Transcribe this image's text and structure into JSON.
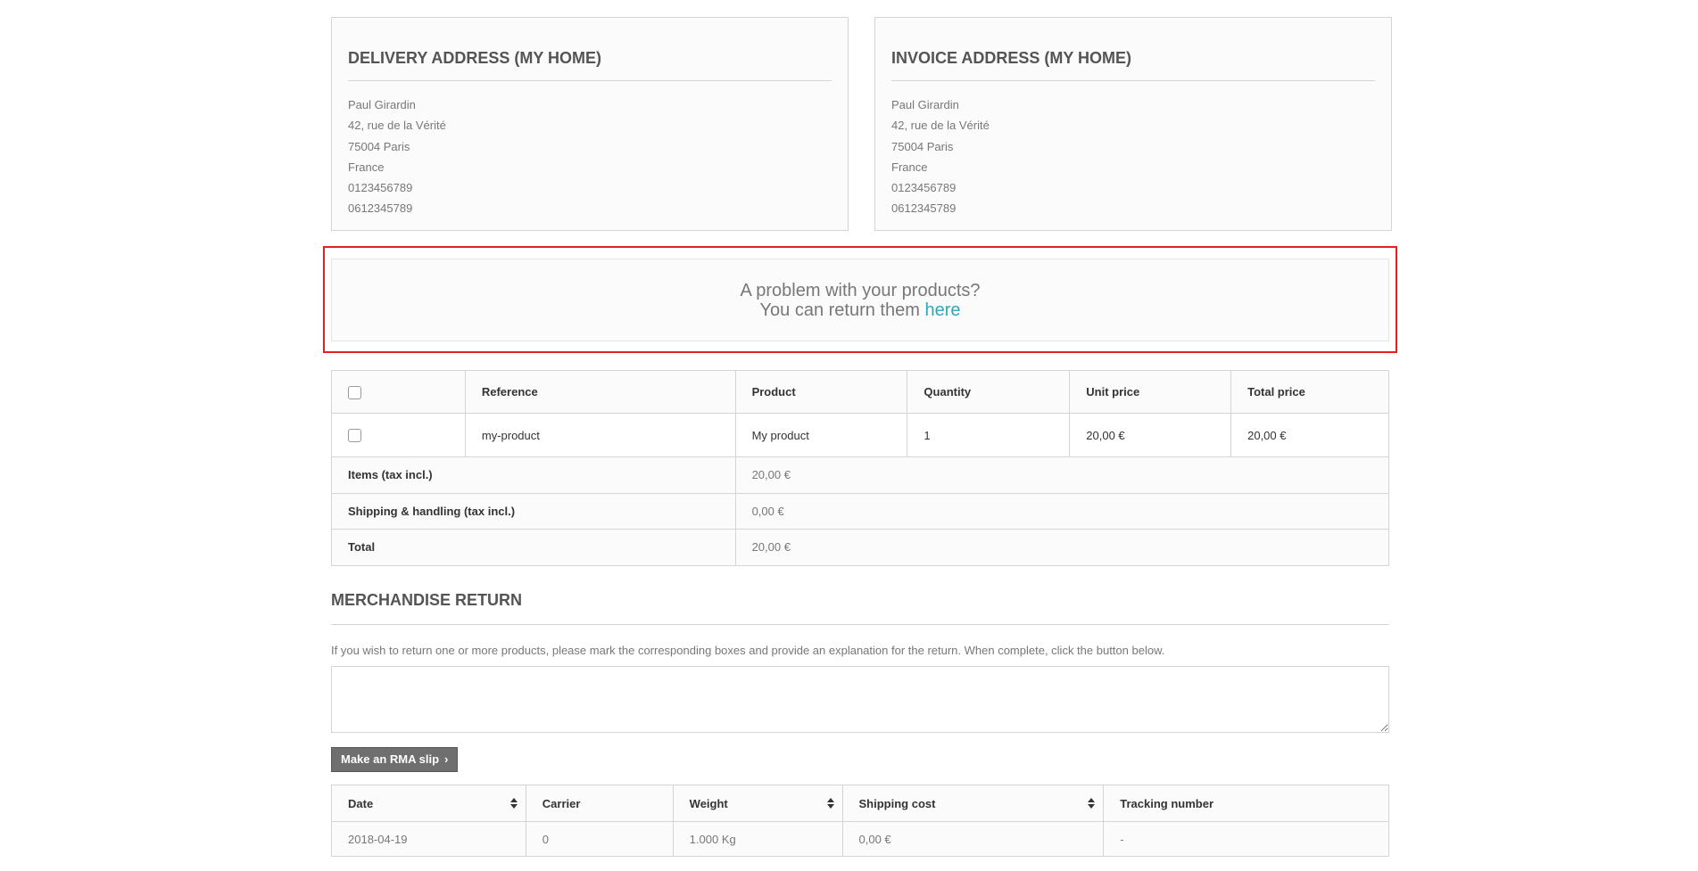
{
  "delivery": {
    "title": "DELIVERY ADDRESS (MY HOME)",
    "lines": [
      "Paul Girardin",
      "42, rue de la Vérité",
      "75004 Paris",
      "France",
      "0123456789",
      "0612345789"
    ]
  },
  "invoice": {
    "title": "INVOICE ADDRESS (MY HOME)",
    "lines": [
      "Paul Girardin",
      "42, rue de la Vérité",
      "75004 Paris",
      "France",
      "0123456789",
      "0612345789"
    ]
  },
  "return_notice": {
    "line1": "A problem with your products?",
    "line2": "You can return them",
    "link": "here",
    "highlight_color": "#e62020",
    "link_color": "#2aa8c0"
  },
  "products_table": {
    "headers": [
      "Reference",
      "Product",
      "Quantity",
      "Unit price",
      "Total price"
    ],
    "rows": [
      {
        "reference": "my-product",
        "product": "My product",
        "quantity": "1",
        "unit_price": "20,00 €",
        "total_price": "20,00 €"
      }
    ],
    "totals": [
      {
        "label": "Items (tax incl.)",
        "value": "20,00 €"
      },
      {
        "label": "Shipping & handling (tax incl.)",
        "value": "0,00 €"
      },
      {
        "label": "Total",
        "value": "20,00 €"
      }
    ]
  },
  "merchandise_return": {
    "title": "MERCHANDISE RETURN",
    "text": "If you wish to return one or more products, please mark the corresponding boxes and provide an explanation for the return. When complete, click the button below.",
    "button_label": "Make an RMA slip"
  },
  "shipping_table": {
    "headers": [
      "Date",
      "Carrier",
      "Weight",
      "Shipping cost",
      "Tracking number"
    ],
    "rows": [
      {
        "date": "2018-04-19",
        "carrier": "0",
        "weight": "1.000 Kg",
        "cost": "0,00 €",
        "tracking": "-"
      }
    ]
  }
}
